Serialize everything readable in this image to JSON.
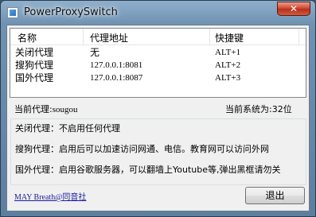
{
  "window": {
    "title": "PowerProxySwitch",
    "close_icon": "close-icon",
    "app_icon": "app-icon"
  },
  "list": {
    "columns": [
      "名称",
      "代理地址",
      "快捷键"
    ],
    "rows": [
      {
        "name": "关闭代理",
        "address": "无",
        "hotkey": "ALT+1"
      },
      {
        "name": "搜狗代理",
        "address": "127.0.0.1:8081",
        "hotkey": "ALT+2"
      },
      {
        "name": "国外代理",
        "address": "127.0.0.1:8087",
        "hotkey": "ALT+3"
      }
    ]
  },
  "status": {
    "current_proxy_label": "当前代理:",
    "current_proxy_value": "sougou",
    "system_label": "当前系统为:32位"
  },
  "descriptions": [
    "关闭代理：不启用任何代理",
    "搜狗代理：启用后可以加速访问网通、电信。教育网可以访问外网",
    "国外代理：启用谷歌服务器，可以翻墙上Youtube等,弹出黑框请勿关"
  ],
  "footer": {
    "link_text": "MAY Breath@同音社",
    "exit_label": "退出"
  }
}
